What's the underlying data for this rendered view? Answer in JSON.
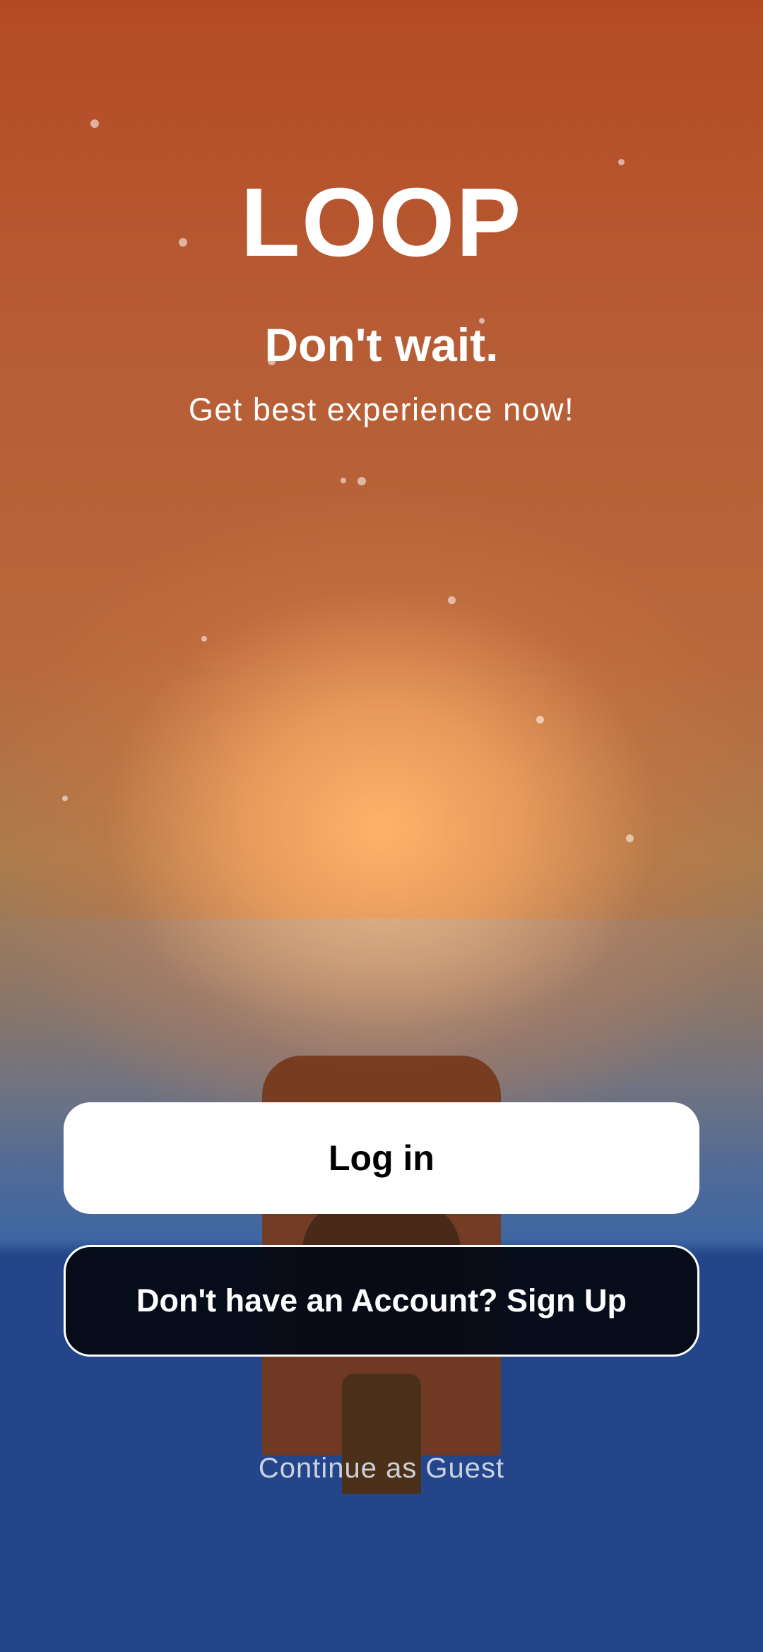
{
  "app": {
    "logo": "LOOP",
    "headline": "Don't wait.",
    "subheadline": "Get best experience now!"
  },
  "actions": {
    "login_label": "Log in",
    "signup_label": "Don't have an Account? Sign Up",
    "guest_label": "Continue as Guest"
  },
  "colors": {
    "sky_top": "#b44a24",
    "sun_glow": "#ffb269",
    "sea": "#24458a",
    "tower": "#76381a",
    "signup_button_bg": "#050a16",
    "login_button_bg": "#ffffff"
  }
}
